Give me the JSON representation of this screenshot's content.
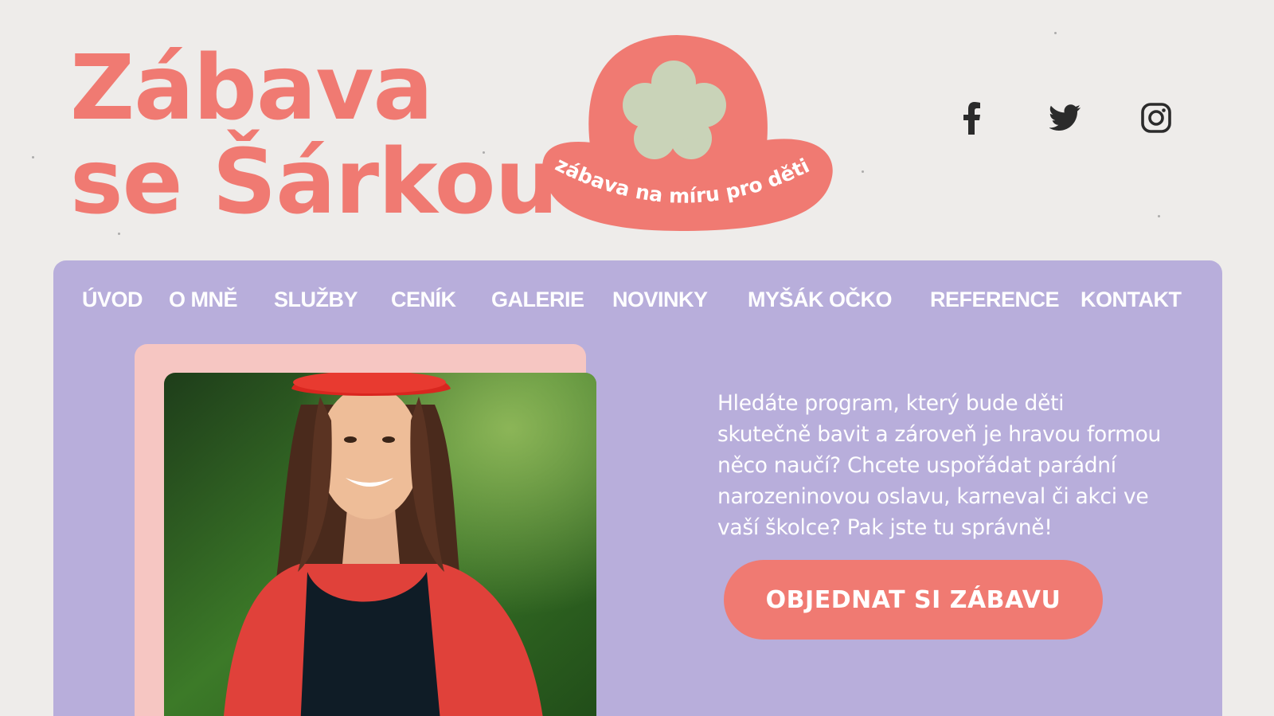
{
  "header": {
    "title_line1": "Zábava",
    "title_line2": "se Šárkou",
    "logo_tagline": "zábava na míru pro děti",
    "logo_icon": "flower-hat-logo"
  },
  "socials": [
    {
      "name": "facebook",
      "icon": "facebook-icon"
    },
    {
      "name": "twitter",
      "icon": "twitter-icon"
    },
    {
      "name": "instagram",
      "icon": "instagram-icon"
    }
  ],
  "nav": {
    "items": [
      "ÚVOD",
      "O MNĚ",
      "SLUŽBY",
      "CENÍK",
      "GALERIE",
      "NOVINKY",
      "MYŠÁK OČKO",
      "REFERENCE",
      "KONTAKT"
    ]
  },
  "hero": {
    "intro": "Hledáte program, který bude děti skutečně bavit a zároveň je hravou formou něco naučí? Chcete uspořádat parádní narozeninovou oslavu, karneval či akci ve vaší školce? Pak jste tu správně!",
    "cta_label": "OBJEDNAT SI ZÁBAVU"
  },
  "colors": {
    "coral": "#f07a72",
    "lavender": "#b8aedb",
    "pink_frame": "#f6c6c2",
    "sage": "#c9d3b8",
    "background": "#eeecea"
  }
}
